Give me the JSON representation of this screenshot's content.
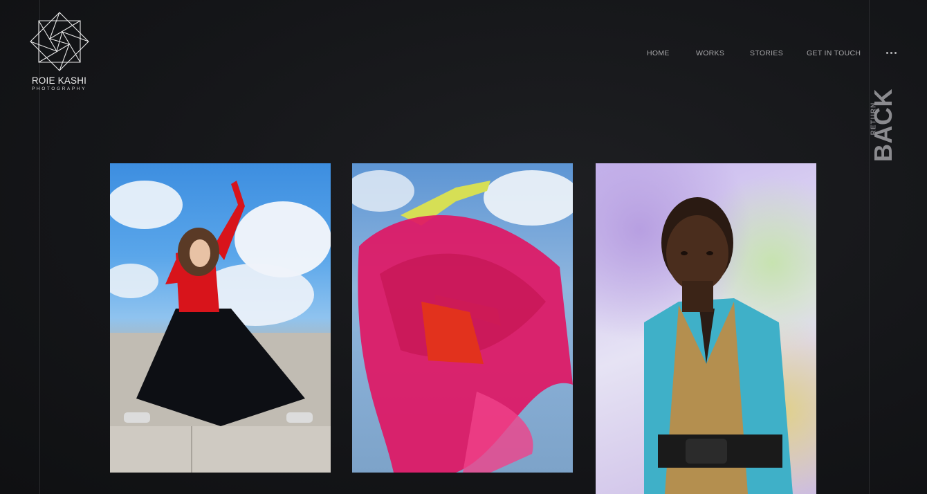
{
  "brand": {
    "name": "ROIE KASHI",
    "subtitle": "PHOTOGRAPHY",
    "logo_icon": "geometric-star-icon"
  },
  "nav": {
    "items": [
      "HOME",
      "WORKS",
      "STORIES",
      "GET IN TOUCH"
    ],
    "more_icon": "more-dots-icon"
  },
  "back": {
    "return_label": "RETURN",
    "back_label": "BACK"
  },
  "gallery": {
    "photos": [
      {
        "name": "photo-dancer-red-top"
      },
      {
        "name": "photo-dancer-pink-tulle"
      },
      {
        "name": "photo-portrait-patterned-coat"
      }
    ]
  },
  "colors": {
    "background": "#151619",
    "nav_text": "#a9a9ab",
    "logo_text": "#ececec"
  }
}
